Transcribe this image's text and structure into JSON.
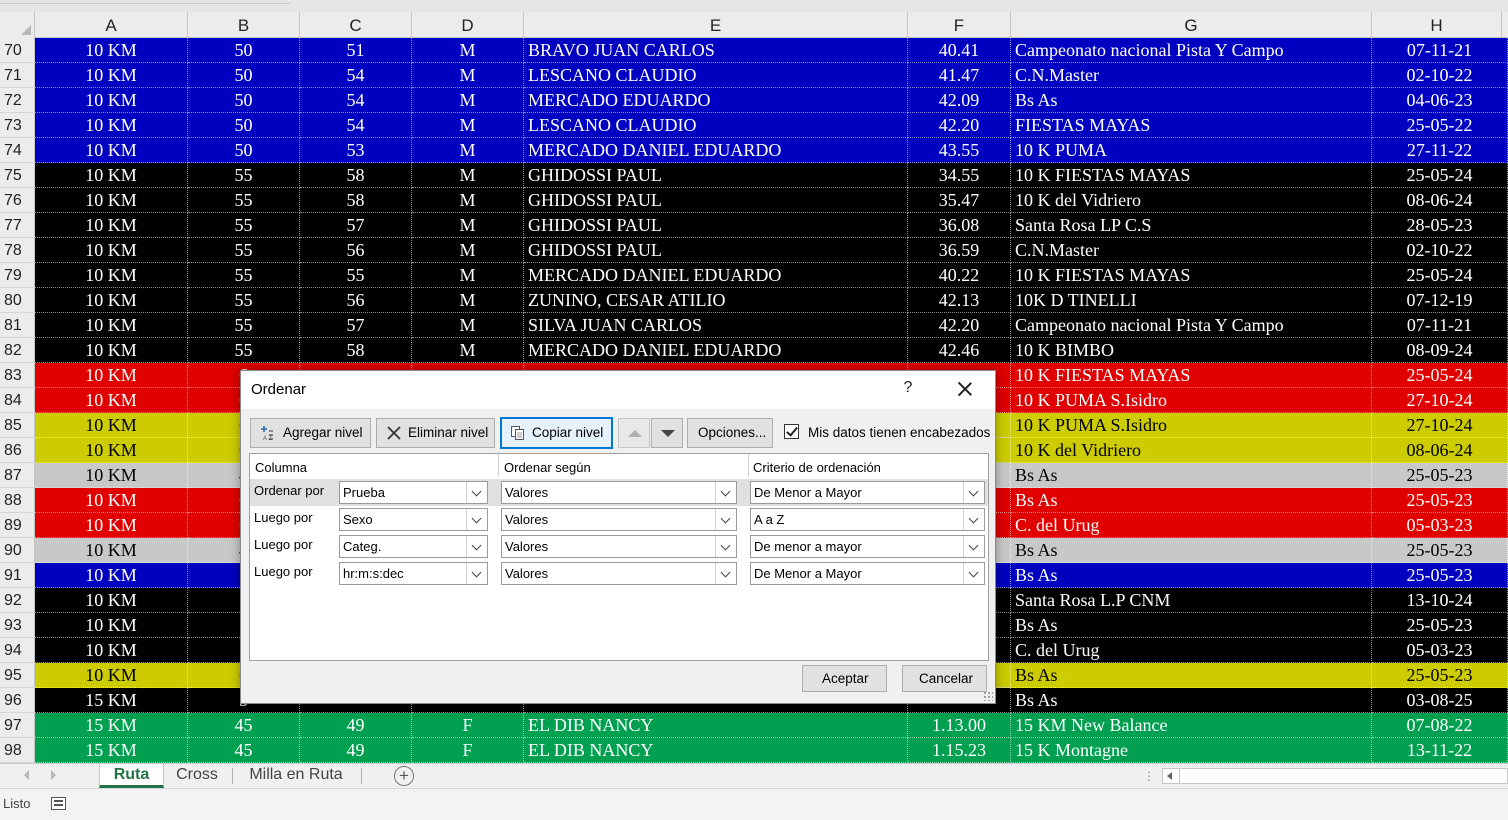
{
  "columns": [
    "A",
    "B",
    "C",
    "D",
    "E",
    "F",
    "G",
    "H"
  ],
  "rows": [
    {
      "n": "70",
      "bg": "blue",
      "A": "10 KM",
      "B": "50",
      "C": "51",
      "D": "M",
      "E": "BRAVO JUAN CARLOS",
      "F": "40.41",
      "G": "Campeonato nacional Pista Y Campo",
      "H": "07-11-21"
    },
    {
      "n": "71",
      "bg": "blue",
      "A": "10 KM",
      "B": "50",
      "C": "54",
      "D": "M",
      "E": "LESCANO CLAUDIO",
      "F": "41.47",
      "G": "C.N.Master",
      "H": "02-10-22"
    },
    {
      "n": "72",
      "bg": "blue",
      "A": "10 KM",
      "B": "50",
      "C": "54",
      "D": "M",
      "E": "MERCADO EDUARDO",
      "F": "42.09",
      "G": "Bs As",
      "H": "04-06-23"
    },
    {
      "n": "73",
      "bg": "blue",
      "A": "10 KM",
      "B": "50",
      "C": "54",
      "D": "M",
      "E": "LESCANO CLAUDIO",
      "F": "42.20",
      "G": "FIESTAS MAYAS",
      "H": "25-05-22"
    },
    {
      "n": "74",
      "bg": "blue",
      "A": "10 KM",
      "B": "50",
      "C": "53",
      "D": "M",
      "E": "MERCADO DANIEL EDUARDO",
      "F": "43.55",
      "G": "10 K PUMA",
      "H": "27-11-22"
    },
    {
      "n": "75",
      "bg": "black",
      "A": "10 KM",
      "B": "55",
      "C": "58",
      "D": "M",
      "E": "GHIDOSSI PAUL",
      "F": "34.55",
      "G": "10 K FIESTAS MAYAS",
      "H": "25-05-24"
    },
    {
      "n": "76",
      "bg": "black",
      "A": "10 KM",
      "B": "55",
      "C": "58",
      "D": "M",
      "E": "GHIDOSSI PAUL",
      "F": "35.47",
      "G": "10 K del  Vidriero",
      "H": "08-06-24"
    },
    {
      "n": "77",
      "bg": "black",
      "A": "10 KM",
      "B": "55",
      "C": "57",
      "D": "M",
      "E": "GHIDOSSI PAUL",
      "F": "36.08",
      "G": "Santa Rosa LP C.S",
      "H": "28-05-23"
    },
    {
      "n": "78",
      "bg": "black",
      "A": "10 KM",
      "B": "55",
      "C": "56",
      "D": "M",
      "E": "GHIDOSSI PAUL",
      "F": "36.59",
      "G": "C.N.Master",
      "H": "02-10-22"
    },
    {
      "n": "79",
      "bg": "black",
      "A": "10 KM",
      "B": "55",
      "C": "55",
      "D": "M",
      "E": "MERCADO DANIEL EDUARDO",
      "F": "40.22",
      "G": "10  K FIESTAS MAYAS",
      "H": "25-05-24"
    },
    {
      "n": "80",
      "bg": "black",
      "A": "10 KM",
      "B": "55",
      "C": "56",
      "D": "M",
      "E": "ZUNINO, CESAR ATILIO",
      "F": "42.13",
      "G": "10K D TINELLI",
      "H": "07-12-19"
    },
    {
      "n": "81",
      "bg": "black",
      "A": "10 KM",
      "B": "55",
      "C": "57",
      "D": "M",
      "E": "SILVA JUAN CARLOS",
      "F": "42.20",
      "G": "Campeonato nacional Pista Y Campo",
      "H": "07-11-21"
    },
    {
      "n": "82",
      "bg": "black",
      "A": "10 KM",
      "B": "55",
      "C": "58",
      "D": "M",
      "E": "MERCADO DANIEL EDUARDO",
      "F": "42.46",
      "G": "10 K BIMBO",
      "H": "08-09-24"
    },
    {
      "n": "83",
      "bg": "red",
      "A": "10 KM",
      "B": "6",
      "C": "",
      "D": "",
      "E": "",
      "F": "",
      "G": "10  K FIESTAS MAYAS",
      "H": "25-05-24"
    },
    {
      "n": "84",
      "bg": "red",
      "A": "10 KM",
      "B": "6",
      "C": "",
      "D": "",
      "E": "",
      "F": "",
      "G": "10 K PUMA S.Isidro",
      "H": "27-10-24"
    },
    {
      "n": "85",
      "bg": "yellow",
      "A": "10 KM",
      "B": "6",
      "C": "",
      "D": "",
      "E": "",
      "F": "",
      "G": "10 K PUMA S.Isidro",
      "H": "27-10-24"
    },
    {
      "n": "86",
      "bg": "yellow",
      "A": "10 KM",
      "B": "6",
      "C": "",
      "D": "",
      "E": "",
      "F": "",
      "G": "10 K del  Vidriero",
      "H": "08-06-24"
    },
    {
      "n": "87",
      "bg": "gray",
      "A": "10 KM",
      "B": "4",
      "C": "",
      "D": "",
      "E": "",
      "F": "",
      "G": "Bs As",
      "H": "25-05-23"
    },
    {
      "n": "88",
      "bg": "red",
      "A": "10 KM",
      "B": "6",
      "C": "",
      "D": "",
      "E": "",
      "F": "",
      "G": "Bs As",
      "H": "25-05-23"
    },
    {
      "n": "89",
      "bg": "red",
      "A": "10 KM",
      "B": "6",
      "C": "",
      "D": "",
      "E": "",
      "F": "",
      "G": "C. del Urug",
      "H": "05-03-23"
    },
    {
      "n": "90",
      "bg": "gray",
      "A": "10 KM",
      "B": "4",
      "C": "",
      "D": "",
      "E": "",
      "F": "",
      "G": "Bs As",
      "H": "25-05-23"
    },
    {
      "n": "91",
      "bg": "blue",
      "A": "10 KM",
      "B": "5",
      "C": "",
      "D": "",
      "E": "",
      "F": "",
      "G": "Bs As",
      "H": "25-05-23"
    },
    {
      "n": "92",
      "bg": "black",
      "A": "10 KM",
      "B": "5",
      "C": "",
      "D": "",
      "E": "",
      "F": "",
      "G": "Santa Rosa L.P CNM",
      "H": "13-10-24"
    },
    {
      "n": "93",
      "bg": "black",
      "A": "10 KM",
      "B": "5",
      "C": "",
      "D": "",
      "E": "",
      "F": "",
      "G": "Bs As",
      "H": "25-05-23"
    },
    {
      "n": "94",
      "bg": "black",
      "A": "10 KM",
      "B": "5",
      "C": "",
      "D": "",
      "E": "",
      "F": "",
      "G": "C. del Urug",
      "H": "05-03-23"
    },
    {
      "n": "95",
      "bg": "yellow",
      "A": "10 KM",
      "B": "6",
      "C": "",
      "D": "",
      "E": "",
      "F": "",
      "G": "Bs As",
      "H": "25-05-23"
    },
    {
      "n": "96",
      "bg": "black",
      "A": "15  KM",
      "B": "5",
      "C": "",
      "D": "",
      "E": "",
      "F": "",
      "G": "Bs As",
      "H": "03-08-25"
    },
    {
      "n": "97",
      "bg": "green",
      "A": "15 KM",
      "B": "45",
      "C": "49",
      "D": "F",
      "E": "EL DIB NANCY",
      "F": "1.13.00",
      "G": "15 KM New Balance",
      "H": "07-08-22"
    },
    {
      "n": "98",
      "bg": "green",
      "A": "15 KM",
      "B": "45",
      "C": "49",
      "D": "F",
      "E": "EL DIB NANCY",
      "F": "1.15.23",
      "G": "15 K Montagne",
      "H": "13-11-22"
    }
  ],
  "colors": {
    "blue": "#0000c0",
    "black": "#000000",
    "red": "#e00000",
    "yellow": "#cccc00",
    "gray": "#c8c8c8",
    "green": "#00a050",
    "accent": "#217346",
    "focus": "#0078d7"
  },
  "dialog": {
    "title": "Ordenar",
    "help": "?",
    "close_icon": "close-icon",
    "add_level": "Agregar nivel",
    "delete_level": "Eliminar nivel",
    "copy_level": "Copiar nivel",
    "options": "Opciones...",
    "headers_checkbox_label": "Mis datos tienen encabezados",
    "headers_checked": true,
    "col_header_column": "Columna",
    "col_header_sort_on": "Ordenar según",
    "col_header_order": "Criterio de ordenación",
    "levels": [
      {
        "label": "Ordenar por",
        "column": "Prueba",
        "sort_on": "Valores",
        "order": "De Menor a Mayor"
      },
      {
        "label": "Luego por",
        "column": "Sexo",
        "sort_on": "Valores",
        "order": "A a Z"
      },
      {
        "label": "Luego por",
        "column": "Categ.",
        "sort_on": "Valores",
        "order": "De menor a mayor"
      },
      {
        "label": "Luego por",
        "column": "hr:m:s:dec",
        "sort_on": "Valores",
        "order": "De Menor a Mayor"
      }
    ],
    "ok": "Aceptar",
    "cancel": "Cancelar"
  },
  "sheet_tabs": [
    {
      "label": "Ruta",
      "active": true
    },
    {
      "label": "Cross",
      "active": false
    },
    {
      "label": "Milla en Ruta",
      "active": false
    }
  ],
  "add_sheet": "+",
  "status": "Listo"
}
